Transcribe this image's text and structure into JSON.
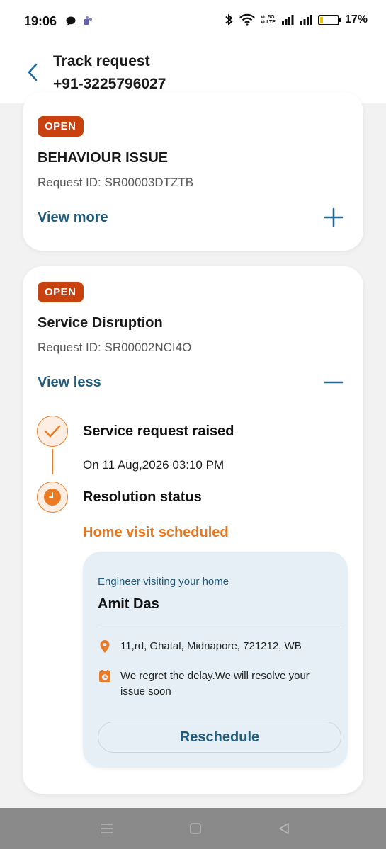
{
  "status_bar": {
    "time": "19:06",
    "volte_line1": "Vo 5G",
    "volte_line2": "VoLTE",
    "battery_percent": "17%",
    "battery_level": 0.17,
    "battery_color": "#f3c400"
  },
  "header": {
    "title": "Track request",
    "subtitle": "+91-3225796027",
    "back_icon": "chevron-left-icon"
  },
  "requests": [
    {
      "status": "OPEN",
      "title": "BEHAVIOUR ISSUE",
      "request_id": "Request ID: SR00003DTZTB",
      "toggle_label": "View more",
      "toggle_icon": "plus-icon"
    },
    {
      "status": "OPEN",
      "title": "Service Disruption",
      "request_id": "Request ID: SR00002NCI4O",
      "toggle_label": "View less",
      "toggle_icon": "minus-icon",
      "timeline": {
        "raised_title": "Service request raised",
        "raised_date": "On 11 Aug,2026 03:10 PM",
        "resolution_title": "Resolution status",
        "resolution_status": "Home visit scheduled"
      },
      "engineer": {
        "label": "Engineer visiting your home",
        "name": "Amit Das",
        "address": "11,rd, Ghatal, Midnapore, 721212, WB",
        "message": "We regret the delay.We will resolve your issue soon",
        "reschedule_label": "Reschedule"
      }
    }
  ],
  "colors": {
    "badge": "#c8410e",
    "link": "#1f5d7e",
    "accent_orange": "#e8771e",
    "engineer_box_bg": "#e5eff5"
  },
  "nav_bar": {
    "icons": [
      "menu-icon",
      "home-square-icon",
      "back-triangle-icon"
    ]
  }
}
